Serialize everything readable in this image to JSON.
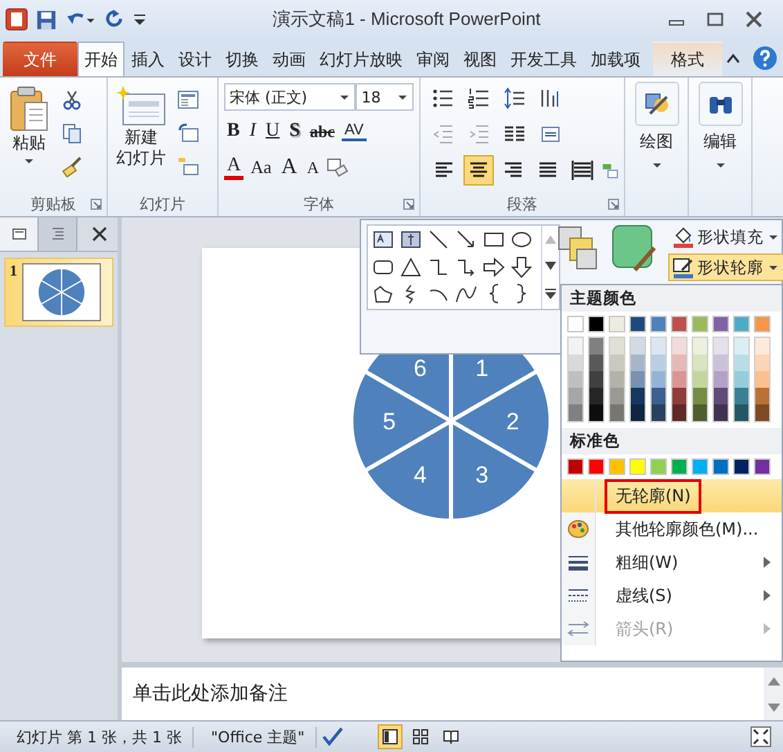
{
  "window": {
    "title": "演示文稿1 - Microsoft PowerPoint"
  },
  "tabs": [
    {
      "label": "文件",
      "kind": "file",
      "selected": false
    },
    {
      "label": "开始",
      "kind": "normal",
      "selected": true
    },
    {
      "label": "插入",
      "kind": "normal",
      "selected": false
    },
    {
      "label": "设计",
      "kind": "normal",
      "selected": false
    },
    {
      "label": "切换",
      "kind": "normal",
      "selected": false
    },
    {
      "label": "动画",
      "kind": "normal",
      "selected": false
    },
    {
      "label": "幻灯片放映",
      "kind": "normal",
      "selected": false
    },
    {
      "label": "审阅",
      "kind": "normal",
      "selected": false
    },
    {
      "label": "视图",
      "kind": "normal",
      "selected": false
    },
    {
      "label": "开发工具",
      "kind": "normal",
      "selected": false
    },
    {
      "label": "加载项",
      "kind": "normal",
      "selected": false
    },
    {
      "label": "格式",
      "kind": "contextual",
      "selected": false
    }
  ],
  "ribbon": {
    "clipboard": {
      "label": "剪贴板",
      "paste": "粘贴"
    },
    "slides": {
      "label": "幻灯片",
      "new_slide": [
        "新建",
        "幻灯片"
      ]
    },
    "font": {
      "label": "字体",
      "font_name": "宋体 (正文)",
      "font_size": "18",
      "row_1": [
        {
          "label": "B",
          "kind": "bold"
        },
        {
          "label": "I",
          "kind": "italic"
        },
        {
          "label": "U",
          "kind": "underline"
        },
        {
          "label": "S",
          "kind": "shadow"
        },
        {
          "label": "abc",
          "kind": "strike"
        },
        {
          "label": "AV",
          "kind": "spacing"
        }
      ],
      "row_2": [
        {
          "label": "A",
          "kind": "color"
        },
        {
          "label": "Aa",
          "kind": "case"
        },
        {
          "label": "A",
          "kind": "grow"
        },
        {
          "label": "A",
          "kind": "shrink"
        }
      ]
    },
    "paragraph": {
      "label": "段落",
      "alignments": [
        {
          "kind": "left",
          "selected": false
        },
        {
          "kind": "center",
          "selected": true
        },
        {
          "kind": "right",
          "selected": false
        },
        {
          "kind": "justify",
          "selected": false
        },
        {
          "kind": "distributed",
          "selected": false
        }
      ]
    },
    "drawing": {
      "button": "绘图"
    },
    "editing": {
      "button": "编辑"
    }
  },
  "drawing_popup": {
    "fill_button": {
      "label": "形状填充",
      "selected": false
    },
    "outline_button": {
      "label": "形状轮廓",
      "selected": true
    }
  },
  "outline_menu": {
    "theme_heading": "主题颜色",
    "theme_colors": [
      {
        "color": "#ffffff"
      },
      {
        "color": "#000000"
      },
      {
        "color": "#eeece1"
      },
      {
        "color": "#1f497d"
      },
      {
        "color": "#4f81bd"
      },
      {
        "color": "#c0504d"
      },
      {
        "color": "#9bbb59"
      },
      {
        "color": "#8064a2"
      },
      {
        "color": "#4bacc6"
      },
      {
        "color": "#f79646"
      }
    ],
    "standard_heading": "标准色",
    "standard_colors": [
      {
        "color": "#c00000"
      },
      {
        "color": "#ff0000"
      },
      {
        "color": "#ffc000"
      },
      {
        "color": "#ffff00"
      },
      {
        "color": "#92d050"
      },
      {
        "color": "#00b050"
      },
      {
        "color": "#00b0f0"
      },
      {
        "color": "#0070c0"
      },
      {
        "color": "#002060"
      },
      {
        "color": "#7030a0"
      }
    ],
    "items": [
      {
        "label": "无轮廓(N)",
        "kind": "no_outline",
        "selected": true,
        "marked": true,
        "submenu": false,
        "disabled": false
      },
      {
        "label": "其他轮廓颜色(M)...",
        "kind": "more_colors",
        "selected": false,
        "marked": false,
        "submenu": false,
        "disabled": false
      },
      {
        "label": "粗细(W)",
        "kind": "weight",
        "selected": false,
        "marked": false,
        "submenu": true,
        "disabled": false
      },
      {
        "label": "虚线(S)",
        "kind": "dashes",
        "selected": false,
        "marked": false,
        "submenu": true,
        "disabled": false
      },
      {
        "label": "箭头(R)",
        "kind": "arrows",
        "selected": false,
        "marked": false,
        "submenu": true,
        "disabled": true
      }
    ]
  },
  "slide_panel": {
    "tabs": [
      {
        "kind": "slides",
        "selected": true
      },
      {
        "kind": "outline",
        "selected": false
      }
    ],
    "thumbnails": [
      {
        "number": "1",
        "selected": true
      }
    ]
  },
  "slide": {
    "segments": [
      "1",
      "2",
      "3",
      "4",
      "5",
      "6"
    ]
  },
  "notes": {
    "placeholder": "单击此处添加备注"
  },
  "status_bar": {
    "slide_count": "幻灯片 第 1 张，共 1 张",
    "theme": "\"Office 主题\"",
    "views": [
      {
        "kind": "normal",
        "selected": true
      },
      {
        "kind": "sorter",
        "selected": false
      },
      {
        "kind": "reading",
        "selected": false
      }
    ]
  }
}
